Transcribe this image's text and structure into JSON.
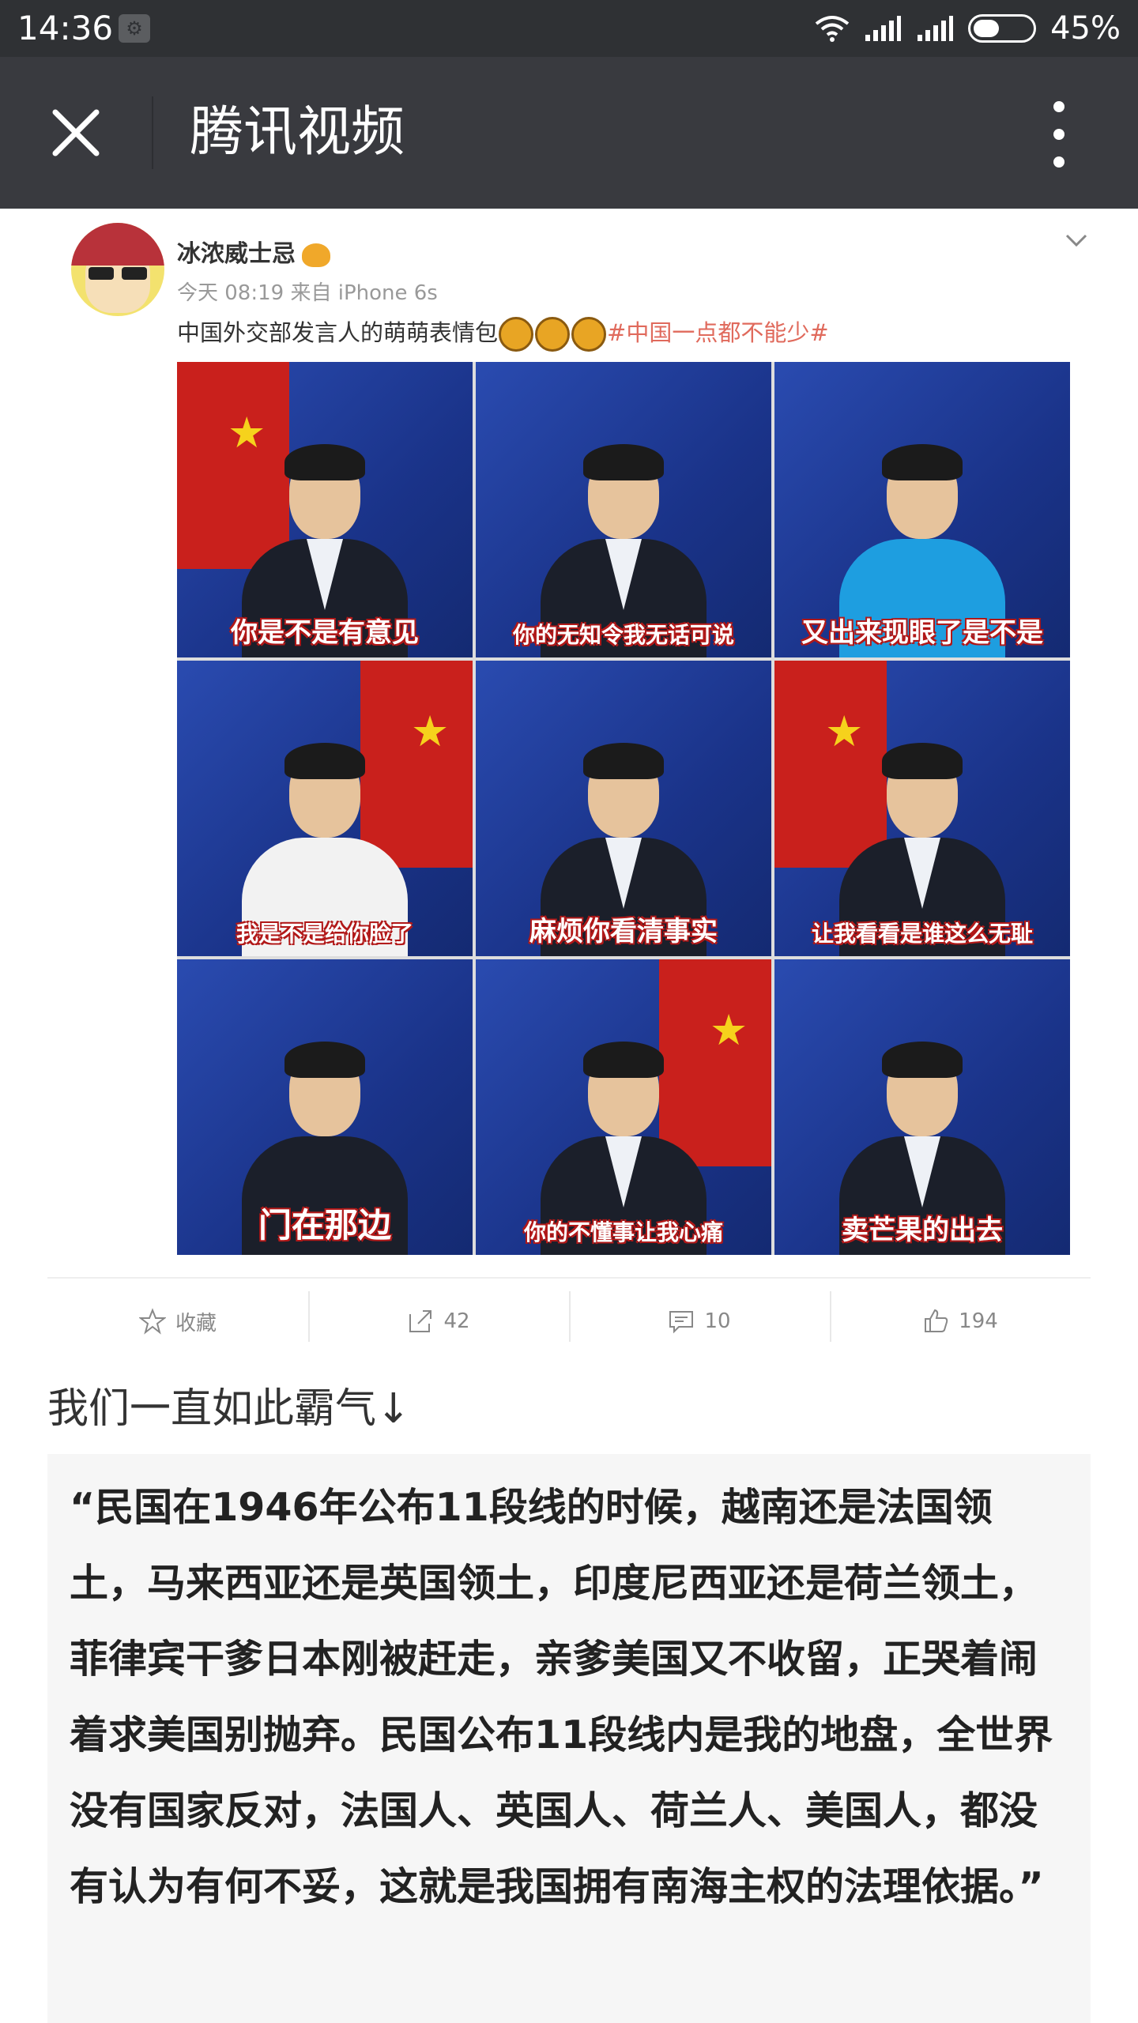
{
  "status": {
    "time": "14:36",
    "battery": "45%",
    "battery_level": 0.45
  },
  "titlebar": {
    "title": "腾讯视频"
  },
  "post": {
    "username": "冰浓威士忌",
    "meta": "今天 08:19 来自 iPhone 6s",
    "text": "中国外交部发言人的萌萌表情包",
    "tag": "#中国一点都不能少#",
    "grid": [
      {
        "caption": "你是不是有意见"
      },
      {
        "caption": "你的无知令我无话可说"
      },
      {
        "caption": "又出来现眼了是不是"
      },
      {
        "caption": "我是不是给你脸了"
      },
      {
        "caption": "麻烦你看清事实"
      },
      {
        "caption": "让我看看是谁这么无耻"
      },
      {
        "caption": "门在那边"
      },
      {
        "caption": "你的不懂事让我心痛"
      },
      {
        "caption": "卖芒果的出去"
      }
    ],
    "actions": {
      "favorite": "收藏",
      "share": "42",
      "comment": "10",
      "like": "194"
    }
  },
  "article": {
    "heading": "我们一直如此霸气↓",
    "quote": "“民国在1946年公布11段线的时候，越南还是法国领土，马来西亚还是英国领土，印度尼西亚还是荷兰领土，菲律宾干爹日本刚被赶走，亲爹美国又不收留，正哭着闹着求美国别抛弃。民国公布11段线内是我的地盘，全世界没有国家反对，法国人、英国人、荷兰人、美国人，都没有认为有何不妥，这就是我国拥有南海主权的法理依据。”"
  }
}
